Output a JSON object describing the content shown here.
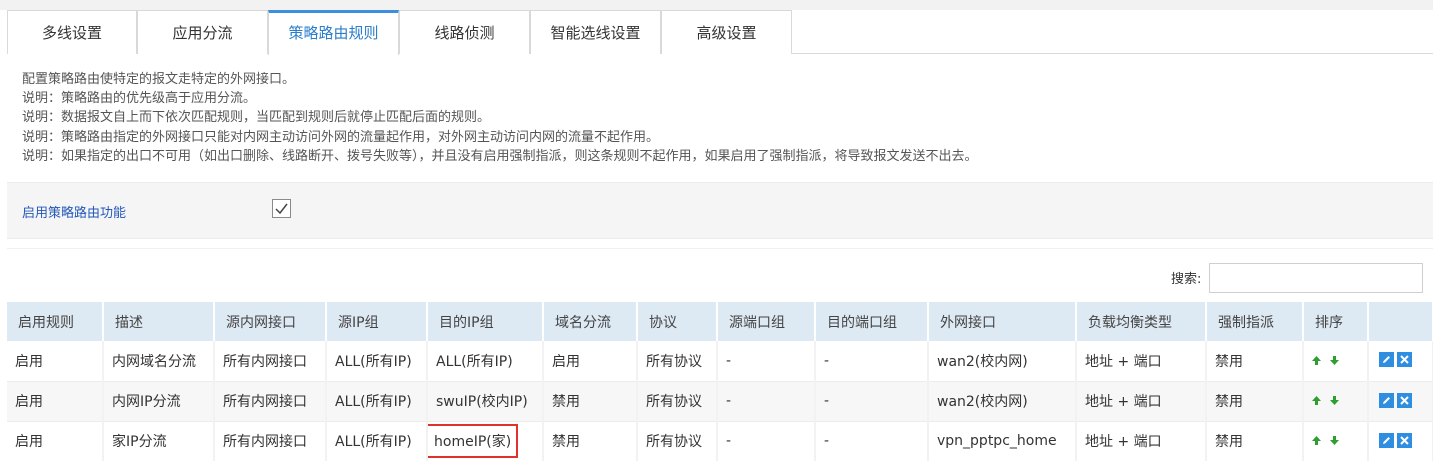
{
  "tabs": [
    {
      "label": "多线设置"
    },
    {
      "label": "应用分流"
    },
    {
      "label": "策略路由规则"
    },
    {
      "label": "线路侦测"
    },
    {
      "label": "智能选线设置"
    },
    {
      "label": "高级设置"
    }
  ],
  "description": [
    "配置策略路由使特定的报文走特定的外网接口。",
    "说明：策略路由的优先级高于应用分流。",
    "说明：数据报文自上而下依次匹配规则，当匹配到规则后就停止匹配后面的规则。",
    "说明：策略路由指定的外网接口只能对内网主动访问外网的流量起作用，对外网主动访问内网的流量不起作用。",
    "说明：如果指定的出口不可用（如出口删除、线路断开、拨号失败等），并且没有启用强制指派，则这条规则不起作用，如果启用了强制指派，将导致报文发送不出去。"
  ],
  "enable": {
    "label": "启用策略路由功能",
    "checked": true
  },
  "search": {
    "label": "搜索:",
    "value": ""
  },
  "table": {
    "headers": [
      "启用规则",
      "描述",
      "源内网接口",
      "源IP组",
      "目的IP组",
      "域名分流",
      "协议",
      "源端口组",
      "目的端口组",
      "外网接口",
      "负载均衡类型",
      "强制指派",
      "排序",
      ""
    ],
    "rows": [
      [
        "启用",
        "内网域名分流",
        "所有内网接口",
        "ALL(所有IP)",
        "ALL(所有IP)",
        "启用",
        "所有协议",
        "-",
        "-",
        "wan2(校内网)",
        "地址 + 端口",
        "禁用"
      ],
      [
        "启用",
        "内网IP分流",
        "所有内网接口",
        "ALL(所有IP)",
        "swuIP(校内IP)",
        "禁用",
        "所有协议",
        "-",
        "-",
        "wan2(校内网)",
        "地址 + 端口",
        "禁用"
      ],
      [
        "启用",
        "家IP分流",
        "所有内网接口",
        "ALL(所有IP)",
        "homeIP(家)",
        "禁用",
        "所有协议",
        "-",
        "-",
        "vpn_pptpc_home",
        "地址 + 端口",
        "禁用"
      ]
    ]
  },
  "colors": {
    "accent": "#3b8fdc",
    "header_bg": "#dde9f3",
    "highlight": "#e0312d",
    "arrow_green": "#2e9e2e",
    "op_blue": "#2f8ee0"
  },
  "icons": {
    "sort": [
      "arrow-up-icon",
      "arrow-down-icon"
    ],
    "ops": [
      "edit-icon",
      "delete-icon"
    ]
  }
}
